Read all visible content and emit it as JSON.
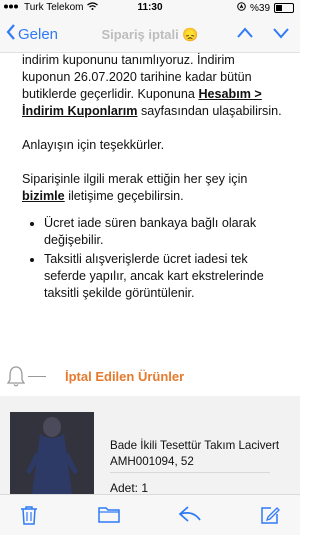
{
  "status": {
    "carrier": "Turk Telekom",
    "time": "11:30",
    "battery_percent": "%39",
    "battery_level": 0.39
  },
  "nav": {
    "back_label": "Gelen",
    "title": "Sipariş iptali 😞"
  },
  "message": {
    "p1_a": "indirim kuponunu tanımlıyoruz. İndirim kuponun 26.07.2020 tarihine kadar bütün butiklerde geçerlidir. Kuponuna ",
    "p1_link": "Hesabım > İndirim Kuponlarım",
    "p1_b": " sayfasından ulaşabilirsin.",
    "p2": "Anlayışın için teşekkürler.",
    "p3_a": "Siparişinle ilgili merak ettiğin her şey için ",
    "p3_link": "bizimle",
    "p3_b": " iletişime geçebilirsin.",
    "bullets": [
      "Ücret iade süren bankaya bağlı olarak değişebilir.",
      "Taksitli alışverişlerde ücret iadesi tek seferde yapılır, ancak kart ekstrelerinde taksitli şekilde görüntülenir."
    ]
  },
  "section": {
    "title": "İptal Edilen Ürünler"
  },
  "product": {
    "name": "Bade İkili Tesettür Takım Lacivert AMH001094, 52",
    "quantity": "Adet: 1"
  },
  "toolbar": {
    "icons": [
      "trash-icon",
      "folder-icon",
      "reply-icon",
      "compose-icon"
    ],
    "accent": "#2f7bf5"
  }
}
